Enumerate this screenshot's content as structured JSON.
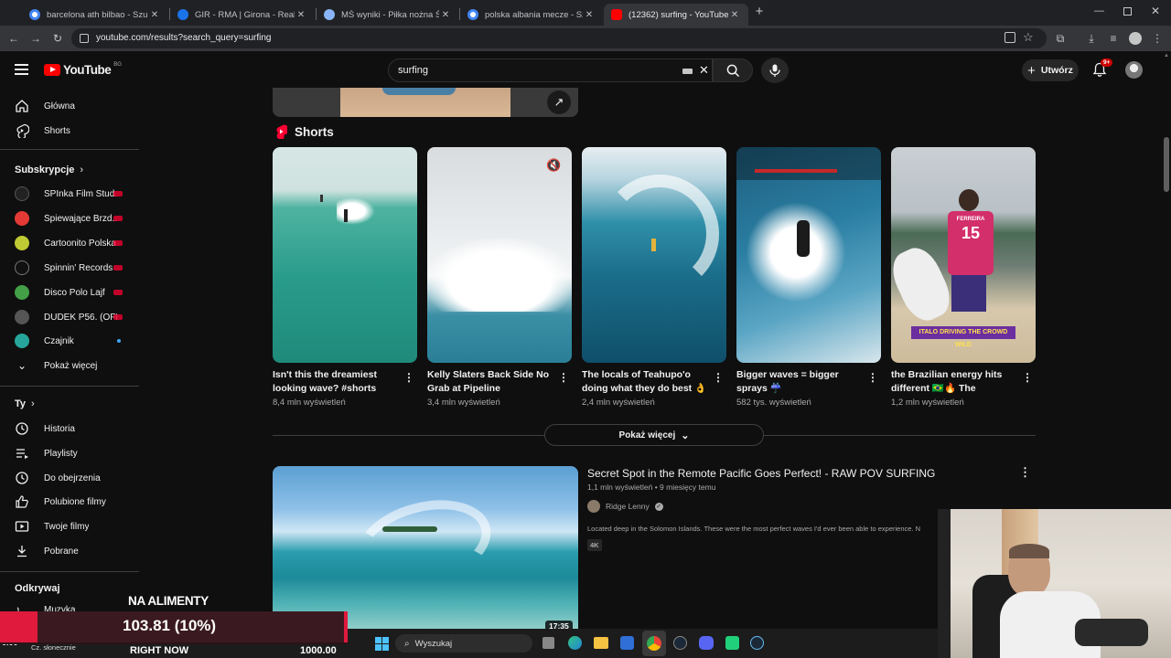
{
  "browser": {
    "tabs": [
      {
        "title": "barcelona ath bilbao - Szukaj w Go",
        "color": "#5f6368"
      },
      {
        "title": "GIR - RMA | Girona - Real Madrid",
        "color": "#1a73e8"
      },
      {
        "title": "MŚ wyniki - Piłka nożna Świat",
        "color": "#8ab4f8"
      },
      {
        "title": "polska albania mecze - Szukaj w G",
        "color": "#5f6368"
      },
      {
        "title": "(12362) surfing - YouTube",
        "color": "#ff0000"
      }
    ],
    "url": "youtube.com/results?search_query=surfing"
  },
  "youtube": {
    "logo_text": "YouTube",
    "country_code": "BG",
    "search_value": "surfing",
    "create_label": "Utwórz",
    "notif_badge": "9+"
  },
  "sidebar": {
    "main": [
      {
        "label": "Główna",
        "icon": "home-icon"
      },
      {
        "label": "Shorts",
        "icon": "shorts-icon"
      }
    ],
    "subs_heading": "Subskrypcje",
    "subs": [
      {
        "label": "SPInka Film Stud...",
        "color": "#222",
        "status": "live"
      },
      {
        "label": "Śpiewające Brzd...",
        "color": "#e53935",
        "status": "live"
      },
      {
        "label": "Cartoonito Polska",
        "color": "#c0ca33",
        "status": "live"
      },
      {
        "label": "Spinnin' Records",
        "color": "#111",
        "status": "live"
      },
      {
        "label": "Disco Polo Lajf",
        "color": "#43a047",
        "status": "live"
      },
      {
        "label": "DUDEK P56. (OFI...",
        "color": "#555",
        "status": "live"
      },
      {
        "label": "Czajnik",
        "color": "#26a69a",
        "status": "new"
      }
    ],
    "show_more": "Pokaż więcej",
    "you_heading": "Ty",
    "you": [
      {
        "label": "Historia",
        "icon": "history-icon"
      },
      {
        "label": "Playlisty",
        "icon": "playlist-icon"
      },
      {
        "label": "Do obejrzenia",
        "icon": "watch-later-icon"
      },
      {
        "label": "Polubione filmy",
        "icon": "like-icon"
      },
      {
        "label": "Twoje filmy",
        "icon": "your-videos-icon"
      },
      {
        "label": "Pobrane",
        "icon": "download-icon"
      }
    ],
    "explore_heading": "Odkrywaj",
    "explore_first": "Muzyka"
  },
  "shorts": {
    "heading": "Shorts",
    "items": [
      {
        "title": "Isn't this the dreamiest looking wave? #shorts",
        "views": "8,4 mln wyświetleń"
      },
      {
        "title": "Kelly Slaters Back Side No Grab at Pipeline",
        "views": "3,4 mln wyświetleń"
      },
      {
        "title": "The locals of Teahupo'o doing what they do best 👌",
        "views": "2,4 mln wyświetleń"
      },
      {
        "title": "Bigger waves = bigger sprays ☔",
        "views": "582 tys. wyświetleń"
      },
      {
        "title": "the Brazilian energy hits different 🇧🇷🔥 The World's...",
        "views": "1,2 mln wyświetleń"
      }
    ],
    "overlay_caption": "ITALO DRIVING THE CROWD WILD",
    "jersey_name": "FERREIRA",
    "jersey_number": "15",
    "show_more": "Pokaż więcej"
  },
  "video": {
    "title": "Secret Spot in the Remote Pacific Goes Perfect! - RAW POV SURFING",
    "meta": "1,1 mln wyświetleń • 9 miesięcy temu",
    "channel": "Ridge Lenny",
    "description": "Located deep in the Solomon Islands. These were the most perfect waves I'd ever been able to experience. N",
    "badge": "4K",
    "duration": "17:35"
  },
  "overlay": {
    "donation_title": "NA ALIMENTY",
    "donation_value": "103.81 (10%)",
    "donation_goal": "1000.00",
    "right_now": "RIGHT NOW",
    "weather": "Cz. słonecznie",
    "temp": "0.00",
    "search_label": "Wyszukaj"
  }
}
